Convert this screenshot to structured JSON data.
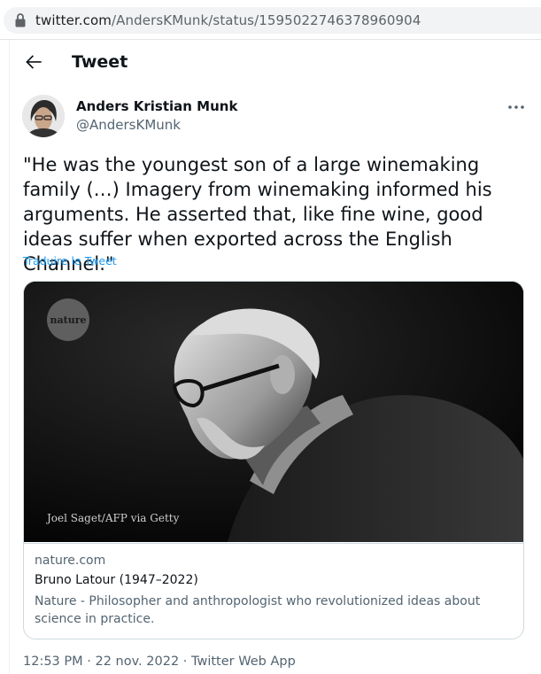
{
  "browser": {
    "url_host": "twitter.com",
    "url_path": "/AndersKMunk/status/1595022746378960904"
  },
  "header": {
    "title": "Tweet"
  },
  "tweet": {
    "author_name": "Anders Kristian Munk",
    "author_handle": "@AndersKMunk",
    "text": "\"He was the youngest son of a large winemaking family (…) Imagery from winemaking informed his arguments. He asserted that, like fine wine, good ideas suffer when exported across the English Channel.\"",
    "translate_label": "Traduire le Tweet",
    "time": "12:53 PM",
    "separator": "·",
    "date": "22 nov. 2022",
    "source": "Twitter Web App"
  },
  "card": {
    "logo_text": "nature",
    "photo_credit": "Joel Saget/AFP via Getty",
    "domain": "nature.com",
    "title": "Bruno Latour (1947–2022)",
    "description": "Nature - Philosopher and anthropologist who revolutionized ideas about science in practice."
  },
  "icons": {
    "lock": "lock-icon",
    "back": "arrow-left-icon",
    "more": "more-horizontal-icon"
  },
  "colors": {
    "link_blue": "#1d9bf0",
    "text_primary": "#0f1419",
    "text_secondary": "#536471",
    "border": "#cfd9de"
  }
}
